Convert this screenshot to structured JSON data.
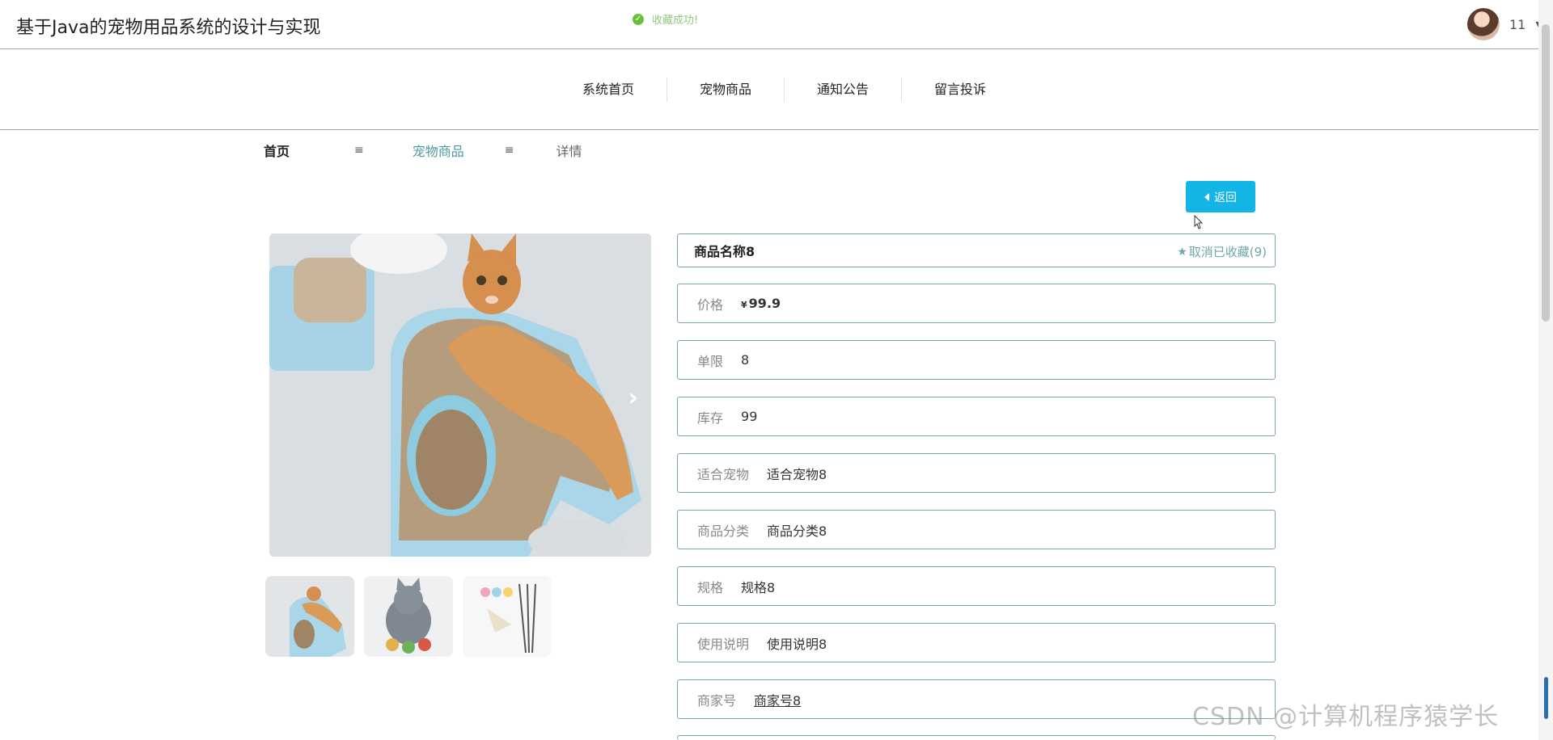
{
  "header": {
    "site_title": "基于Java的宠物用品系统的设计与实现",
    "toast": "收藏成功!",
    "user_name": "11"
  },
  "nav": {
    "items": [
      {
        "label": "系统首页"
      },
      {
        "label": "宠物商品"
      },
      {
        "label": "通知公告"
      },
      {
        "label": "留言投诉"
      }
    ]
  },
  "breadcrumb": {
    "home": "首页",
    "sep": "≡",
    "section": "宠物商品",
    "current": "详情"
  },
  "back_label": "返回",
  "product": {
    "name": "商品名称8",
    "favorite_label": "取消已收藏(9)",
    "price_symbol": "¥",
    "fields": {
      "price_label": "价格",
      "price_value": "99.9",
      "limit_label": "单限",
      "limit_value": "8",
      "stock_label": "库存",
      "stock_value": "99",
      "pet_label": "适合宠物",
      "pet_value": "适合宠物8",
      "category_label": "商品分类",
      "category_value": "商品分类8",
      "spec_label": "规格",
      "spec_value": "规格8",
      "usage_label": "使用说明",
      "usage_value": "使用说明8",
      "seller_label": "商家号",
      "seller_value": "商家号8"
    }
  },
  "watermark": "CSDN @计算机程序猿学长",
  "colors": {
    "accent": "#13b5e6",
    "field_border": "#7aa9a8",
    "price": "#e0251d",
    "toast": "#67c23a",
    "breadcrumb_active": "#4a9aa0"
  }
}
